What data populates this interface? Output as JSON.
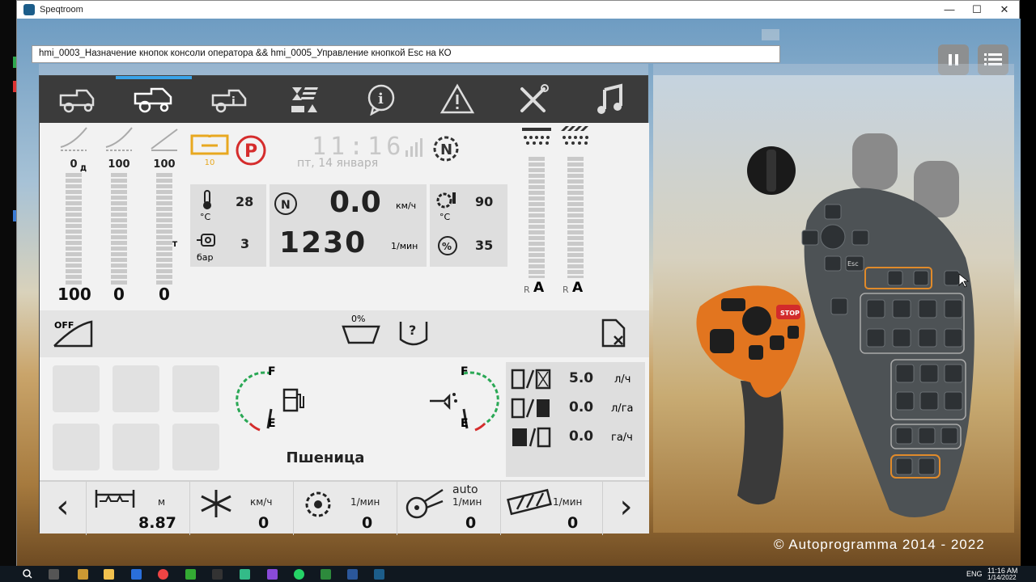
{
  "window": {
    "title": "Speqtroom",
    "minimize": "—",
    "maximize": "☐",
    "close": "✕"
  },
  "script_bar": {
    "text": "hmi_0003_Назначение кнопок консоли оператора && hmi_0005_Управление кнопкой Esc на КО"
  },
  "top_buttons": {
    "pause_icon": "pause-icon",
    "menu_icon": "menu-icon"
  },
  "nav_tabs": [
    {
      "icon": "harvester-icon"
    },
    {
      "icon": "harvester-settings-icon",
      "active": true
    },
    {
      "icon": "harvester-info-icon"
    },
    {
      "icon": "field-settings-icon"
    },
    {
      "icon": "info-icon"
    },
    {
      "icon": "warning-icon"
    },
    {
      "icon": "tools-icon"
    },
    {
      "icon": "music-icon"
    }
  ],
  "header_bars": [
    {
      "top": "0",
      "bottom": "100",
      "marker": "Д"
    },
    {
      "top": "100",
      "bottom": "0"
    },
    {
      "top": "100",
      "bottom": "0",
      "marker": "T"
    }
  ],
  "book_badge": "10",
  "clock": {
    "time": "11:16",
    "date": "пт, 14 января"
  },
  "engine_panel": {
    "temp_unit": "°C",
    "temp_value": "28",
    "pressure_unit": "бар",
    "pressure_value": "3"
  },
  "speed_panel": {
    "speed": "0.0",
    "speed_unit": "км/ч",
    "rpm": "1230",
    "rpm_unit": "1/мин"
  },
  "gear_panel": {
    "temp_unit": "°C",
    "temp_value": "90",
    "percent_value": "35"
  },
  "right_bars": [
    {
      "label": "R",
      "mode": "A"
    },
    {
      "label": "R",
      "mode": "A"
    }
  ],
  "mid_strip": {
    "off_label": "OFF",
    "tank_percent": "0%",
    "unknown_label": "?"
  },
  "crop": "Пшеница",
  "fuel_gauges": {
    "full": "F",
    "empty": "E"
  },
  "consumption": [
    {
      "value": "5.0",
      "unit": "л/ч"
    },
    {
      "value": "0.0",
      "unit": "л/га"
    },
    {
      "value": "0.0",
      "unit": "га/ч"
    }
  ],
  "bottom_bar": {
    "prev": "‹",
    "next": "›",
    "cells": [
      {
        "unit": "м",
        "value": "8.87",
        "icon": "header-width-icon"
      },
      {
        "unit": "км/ч",
        "value": "0",
        "icon": "reel-speed-icon"
      },
      {
        "unit": "1/мин",
        "value": "0",
        "icon": "drum-icon"
      },
      {
        "unit": "1/мин",
        "value": "0",
        "icon": "fan-icon",
        "extra": "auto"
      },
      {
        "unit": "1/мин",
        "value": "0",
        "icon": "auger-icon"
      }
    ]
  },
  "console": {
    "stop_label": "STOP",
    "esc_label": "Esc"
  },
  "copyright": "© Autoprogramma 2014 - 2022",
  "taskbar": {
    "lang": "ENG",
    "time": "11:16 AM",
    "date": "1/14/2022"
  }
}
